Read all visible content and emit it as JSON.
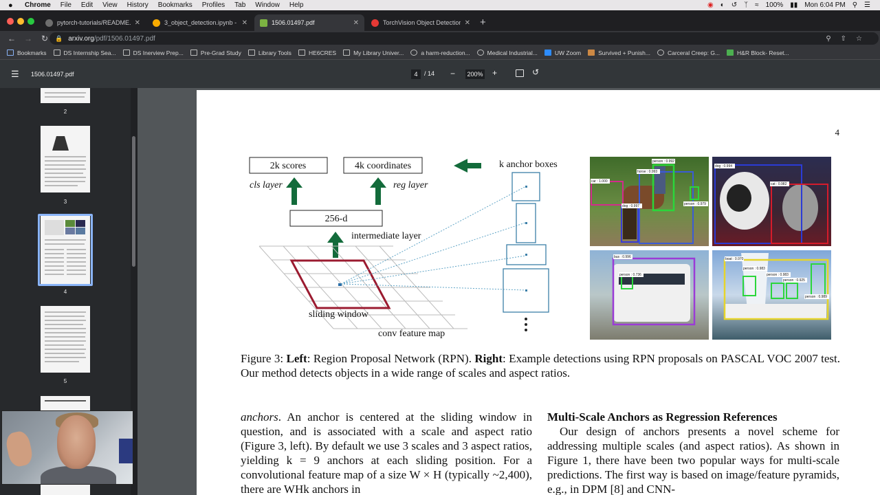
{
  "menubar": {
    "apple": "",
    "items": [
      "Chrome",
      "File",
      "Edit",
      "View",
      "History",
      "Bookmarks",
      "Profiles",
      "Tab",
      "Window",
      "Help"
    ],
    "battery": "100%",
    "clock": "Mon 6:04 PM"
  },
  "tabs": [
    {
      "label": "pytorch-tutorials/README.md",
      "favicon_color": "#6e6e6e"
    },
    {
      "label": "3_object_detection.ipynb - Col",
      "favicon_color": "#f9ab00"
    },
    {
      "label": "1506.01497.pdf",
      "favicon_color": "#7cb342"
    },
    {
      "label": "TorchVision Object Detection F",
      "favicon_color": "#e53935"
    }
  ],
  "omnibox": {
    "domain": "arxiv.org",
    "path": "/pdf/1506.01497.pdf"
  },
  "bookmarks": [
    "Bookmarks",
    "DS Internship Sea...",
    "DS Inerview Prep...",
    "Pre-Grad Study",
    "Library Tools",
    "HE6CRES",
    "My Library Univer...",
    "a harm-reduction...",
    "Medical Industrial...",
    "UW Zoom",
    "Survived + Punish...",
    "Carceral Creep: G...",
    "H&R Block- Reset..."
  ],
  "pdf_toolbar": {
    "filename": "1506.01497.pdf",
    "current_page": "4",
    "total_pages": "/ 14",
    "zoom": "200%",
    "minus": "−",
    "plus": "+"
  },
  "thumbnails": [
    {
      "number": "2"
    },
    {
      "number": "3"
    },
    {
      "number": "4"
    },
    {
      "number": "5"
    }
  ],
  "figure": {
    "box_scores": "2k scores",
    "box_coords": "4k coordinates",
    "cls_layer": "cls layer",
    "reg_layer": "reg layer",
    "anchor_title": "k anchor boxes",
    "box_256": "256-d",
    "intermediate": "intermediate layer",
    "sliding": "sliding window",
    "conv_map": "conv feature map",
    "det_labels": [
      "person : 0.992",
      "horse : 0.993",
      "car : 1.000",
      "dog : 0.997",
      "person : 0.979",
      "dog : 0.994",
      "cat : 0.982",
      "bus : 0.996",
      "person : 0.736",
      "boat : 0.970",
      "person : 0.983",
      "person : 0.983",
      "person : 0.925",
      "person : 0.989"
    ]
  },
  "page": {
    "page_number": "4",
    "caption_prefix": "Figure 3: ",
    "caption_left_bold": "Left",
    "caption_mid": ": Region Proposal Network (RPN). ",
    "caption_right_bold": "Right",
    "caption_rest": ": Example detections using RPN proposals on PASCAL VOC 2007 test. Our method detects objects in a wide range of scales and aspect ratios.",
    "left_col_italic": "anchors",
    "left_col_text": ". An anchor is centered at the sliding window in question, and is associated with a scale and aspect ratio (Figure 3, left). By default we use 3 scales and 3 aspect ratios, yielding k = 9 anchors at each sliding position. For a convolutional feature map of a size W × H (typically ~2,400), there are WHk anchors in",
    "right_heading": "Multi-Scale Anchors as Regression References",
    "right_text": "Our design of anchors presents a novel scheme for addressing multiple scales (and aspect ratios). As shown in Figure 1, there have been two popular ways for multi-scale predictions. The first way is based on image/feature pyramids, e.g., in DPM [8] and CNN-"
  }
}
